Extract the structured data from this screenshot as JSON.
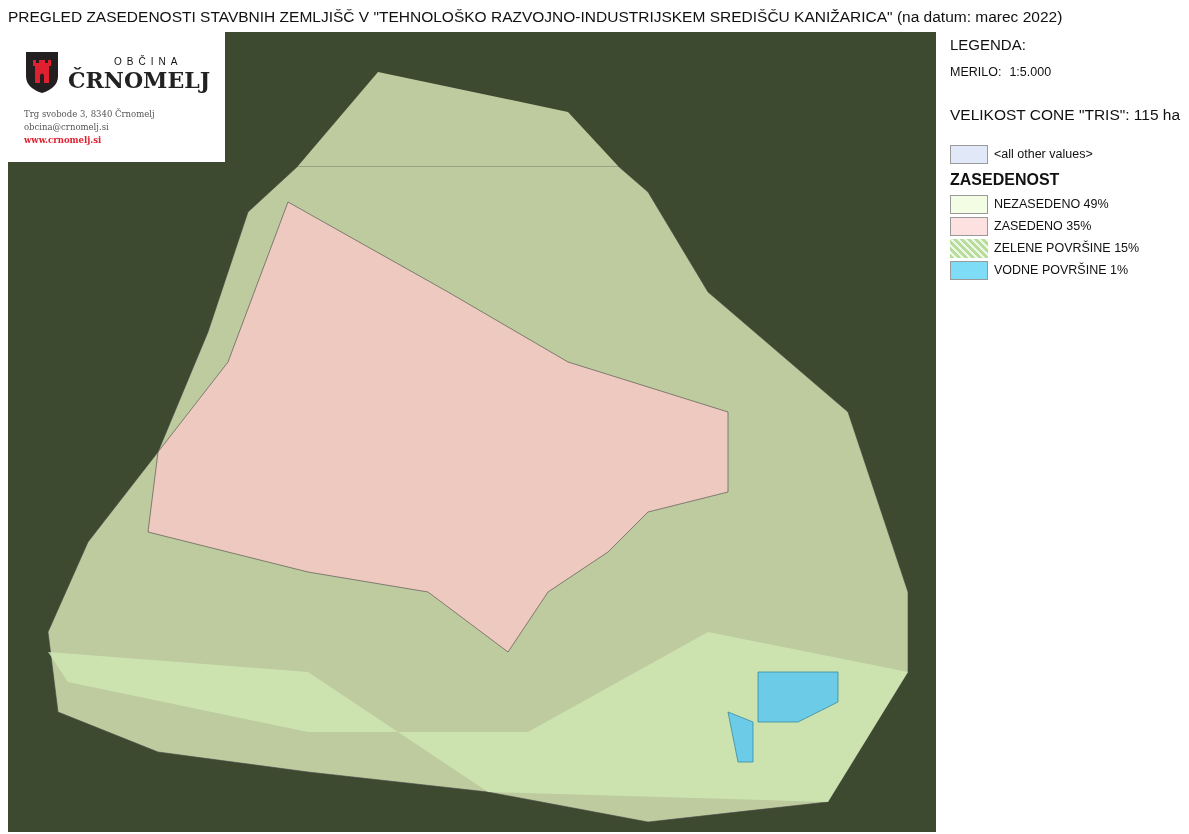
{
  "title": "PREGLED ZASEDENOSTI STAVBNIH ZEMLJIŠČ V \"TEHNOLOŠKO RAZVOJNO-INDUSTRIJSKEM SREDIŠČU KANIŽARICA\" (na datum: marec 2022)",
  "logo": {
    "top_line": "OBČINA",
    "name": "ČRNOMELJ",
    "address": "Trg svobode 3, 8340 Črnomelj",
    "email": "obcina@crnomelj.si",
    "website": "www.crnomelj.si"
  },
  "legend": {
    "heading": "LEGENDA:",
    "scale_label": "MERILO:",
    "scale_value": "1:5.000",
    "zone_size": "VELIKOST CONE \"TRIS\": 115 ha",
    "other": {
      "label": "<all other values>",
      "color": "#e1e8f7",
      "kind": "fill"
    },
    "group_title": "ZASEDENOST",
    "items": [
      {
        "label": "NEZASEDENO 49%",
        "color": "#f2fde3",
        "kind": "fill"
      },
      {
        "label": "ZASEDENO 35%",
        "color": "#fde1e1",
        "kind": "fill"
      },
      {
        "label": "ZELENE POVRŠINE 15%",
        "color": "#b8dc9c",
        "kind": "pattern"
      },
      {
        "label": "VODNE POVRŠINE 1%",
        "color": "#7fdcf7",
        "kind": "fill"
      }
    ]
  }
}
